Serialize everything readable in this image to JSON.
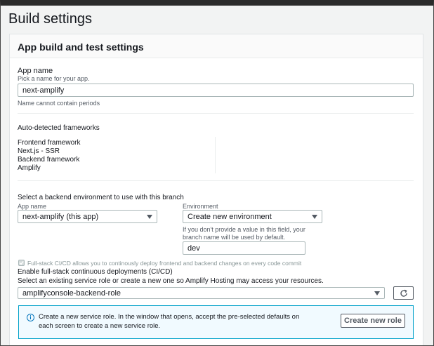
{
  "page": {
    "title": "Build settings"
  },
  "panel": {
    "title": "App build and test settings"
  },
  "app_name": {
    "label": "App name",
    "description": "Pick a name for your app.",
    "value": "next-amplify",
    "constraint": "Name cannot contain periods"
  },
  "frameworks": {
    "heading": "Auto-detected frameworks",
    "frontend_label": "Frontend framework",
    "frontend_value": "Next.js - SSR",
    "backend_label": "Backend framework",
    "backend_value": "Amplify"
  },
  "backend_env": {
    "heading": "Select a backend environment to use with this branch",
    "app_label": "App name",
    "app_selected": "next-amplify (this app)",
    "env_label": "Environment",
    "env_selected": "Create new environment",
    "env_hint": "If you don't provide a value in this field, your branch name will be used by default.",
    "env_value": "dev"
  },
  "cicd": {
    "checkbox_text": "Full-stack CI/CD allows you to continously deploy frontend and backend changes on every code commit",
    "label": "Enable full-stack continuous deployments (CI/CD)",
    "role_prompt": "Select an existing service role or create a new one so Amplify Hosting may access your resources.",
    "role_selected": "amplifyconsole-backend-role"
  },
  "info": {
    "message": "Create a new service role. In the window that opens, accept the pre-selected defaults on each screen to create a new service role.",
    "button_label": "Create new role"
  },
  "icons": {
    "refresh": "refresh-icon",
    "info": "info-icon",
    "check": "check-icon",
    "caret": "chevron-down-icon"
  },
  "colors": {
    "accent": "#0073bb",
    "info_border": "#00a1c9",
    "info_bg": "#f1faff"
  }
}
